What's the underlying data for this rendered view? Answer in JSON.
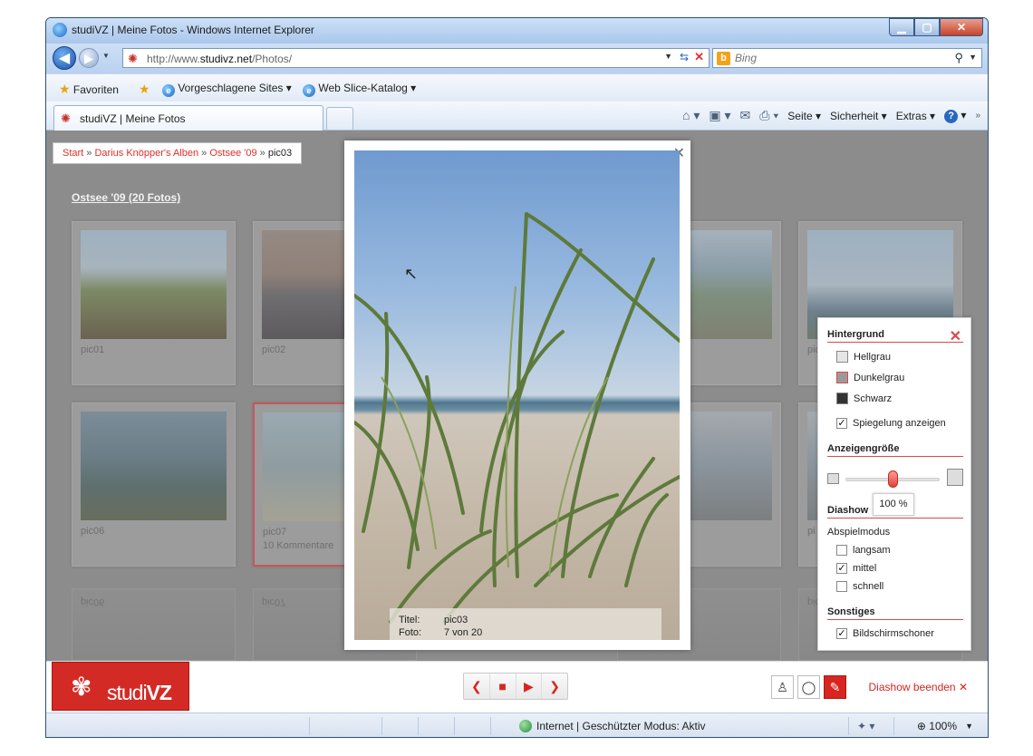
{
  "window": {
    "title": "studiVZ | Meine Fotos - Windows Internet Explorer",
    "controls": {
      "minimize": "▁",
      "maximize": "▢",
      "close": "✕"
    }
  },
  "navbar": {
    "url_prefix": "http://www.",
    "url_domain": "studivz.net",
    "url_path": "/Photos/",
    "search_placeholder": "Bing"
  },
  "favorites": {
    "label": "Favoriten",
    "suggested": "Vorgeschlagene Sites ▾",
    "webslice": "Web Slice-Katalog ▾"
  },
  "tab": {
    "title": "studiVZ | Meine Fotos"
  },
  "commandbar": {
    "page": "Seite ▾",
    "safety": "Sicherheit ▾",
    "extras": "Extras ▾"
  },
  "breadcrumb": {
    "start": "Start",
    "owner": "Darius Knöpper's Alben",
    "album": "Ostsee '09",
    "current": "pic03",
    "sep": "»"
  },
  "album": {
    "title": "Ostsee '09 (20 Fotos)",
    "photos": [
      {
        "name": "pic01",
        "comments": ""
      },
      {
        "name": "pic02",
        "comments": ""
      },
      {
        "name": "pic",
        "comments": ""
      },
      {
        "name": "pic06",
        "comments": ""
      },
      {
        "name": "pic07",
        "comments": "10 Kommentare"
      },
      {
        "name": "pi",
        "comments": ""
      }
    ],
    "reflections": [
      "pic06",
      "pic07",
      "pic"
    ]
  },
  "lightbox": {
    "title_label": "Titel:",
    "title_value": "pic03",
    "photo_label": "Foto:",
    "photo_value": "7 von 20"
  },
  "settings": {
    "background_heading": "Hintergrund",
    "bg_options": [
      {
        "label": "Hellgrau",
        "color": "#e6e6e6"
      },
      {
        "label": "Dunkelgrau",
        "color": "#9a9a9a"
      },
      {
        "label": "Schwarz",
        "color": "#333333"
      }
    ],
    "reflection_label": "Spiegelung anzeigen",
    "reflection_checked": true,
    "size_heading": "Anzeigengröße",
    "size_value": "100 %",
    "slideshow_heading": "Diashow",
    "playback_label": "Abspielmodus",
    "speeds": [
      {
        "label": "langsam",
        "checked": false
      },
      {
        "label": "mittel",
        "checked": true
      },
      {
        "label": "schnell",
        "checked": false
      }
    ],
    "misc_heading": "Sonstiges",
    "screensaver_label": "Bildschirmschoner",
    "screensaver_checked": true
  },
  "bottombar": {
    "logo_prefix": "studi",
    "logo_suffix": "VZ",
    "end_slideshow": "Diashow beenden"
  },
  "statusbar": {
    "zone": "Internet | Geschützter Modus: Aktiv",
    "zoom": "100%"
  },
  "colors": {
    "accent": "#d9251f",
    "overlay": "#8c8c8c"
  }
}
